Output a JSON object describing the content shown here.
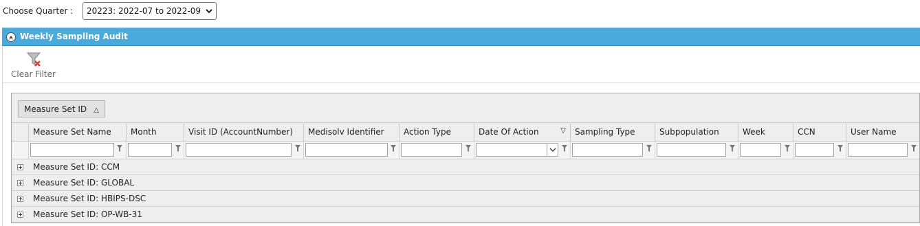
{
  "quarter": {
    "label": "Choose Quarter :",
    "selected": "20223: 2022-07 to 2022-09"
  },
  "panel": {
    "title": "Weekly Sampling Audit",
    "clear_filter_label": "Clear Filter"
  },
  "grid": {
    "group_by_chip": "Measure Set ID",
    "columns": [
      "Measure Set Name",
      "Month",
      "Visit ID (AccountNumber)",
      "Medisolv Identifier",
      "Action Type",
      "Date Of Action",
      "Sampling Type",
      "Subpopulation",
      "Week",
      "CCN",
      "User Name"
    ],
    "groups": [
      "Measure Set ID: CCM",
      "Measure Set ID: GLOBAL",
      "Measure Set ID: HBIPS-DSC",
      "Measure Set ID: OP-WB-31"
    ]
  },
  "icons": {
    "collapse": "collapse-up-icon",
    "clear_filter": "funnel-clear-icon",
    "filter": "filter-icon",
    "expand": "expand-plus-icon",
    "sort_asc": "sort-ascending-icon",
    "sort_desc": "sort-descending-icon"
  },
  "colors": {
    "header_blue": "#4aaadb",
    "clear_x": "#d23a3a"
  }
}
